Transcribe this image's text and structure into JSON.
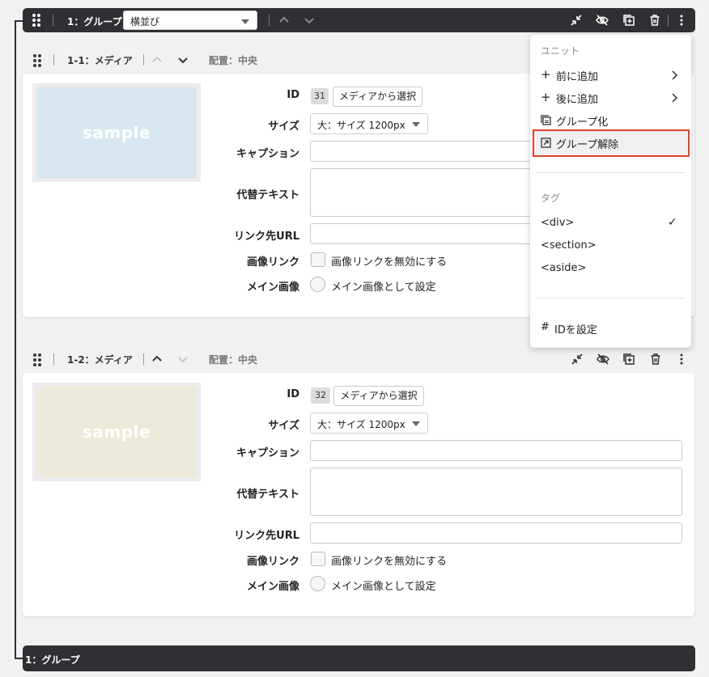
{
  "group": {
    "title": "1：グループ",
    "layout_value": "横並び",
    "footer_title": "1：グループ"
  },
  "units": [
    {
      "title": "1-1：メディア",
      "placement": "配置：中央",
      "image_text": "sample",
      "image_color": "#d8e6ef",
      "id_label": "ID",
      "id_value": "31",
      "select_button": "メディアから選択",
      "size_label": "サイズ",
      "size_value": "大：サイズ 1200px",
      "caption_label": "キャプション",
      "alt_label": "代替テキスト",
      "link_label": "リンク先URL",
      "imglink_label": "画像リンク",
      "imglink_option": "画像リンクを無効にする",
      "main_label": "メイン画像",
      "main_option": "メイン画像として設定"
    },
    {
      "title": "1-2：メディア",
      "placement": "配置：中央",
      "image_text": "sample",
      "image_color": "#ede9da",
      "id_label": "ID",
      "id_value": "32",
      "select_button": "メディアから選択",
      "size_label": "サイズ",
      "size_value": "大：サイズ 1200px",
      "caption_label": "キャプション",
      "alt_label": "代替テキスト",
      "link_label": "リンク先URL",
      "imglink_label": "画像リンク",
      "imglink_option": "画像リンクを無効にする",
      "main_label": "メイン画像",
      "main_option": "メイン画像として設定"
    }
  ],
  "menu": {
    "section_unit": "ユニット",
    "add_before": "前に追加",
    "add_after": "後に追加",
    "group": "グループ化",
    "ungroup": "グループ解除",
    "section_tag": "タグ",
    "tag_div": "<div>",
    "tag_section": "<section>",
    "tag_aside": "<aside>",
    "set_id": "IDを設定",
    "selected_tag_mark": "✓",
    "highlight_color": "#e0432b"
  },
  "icons": {
    "collapse": "collapse-arrows-icon",
    "hide": "eye-slash-icon",
    "duplicate": "duplicate-icon",
    "delete": "trash-icon",
    "more": "kebab-icon",
    "drag": "drag-handle-icon",
    "up": "chevron-up-icon",
    "down": "chevron-down-icon"
  }
}
